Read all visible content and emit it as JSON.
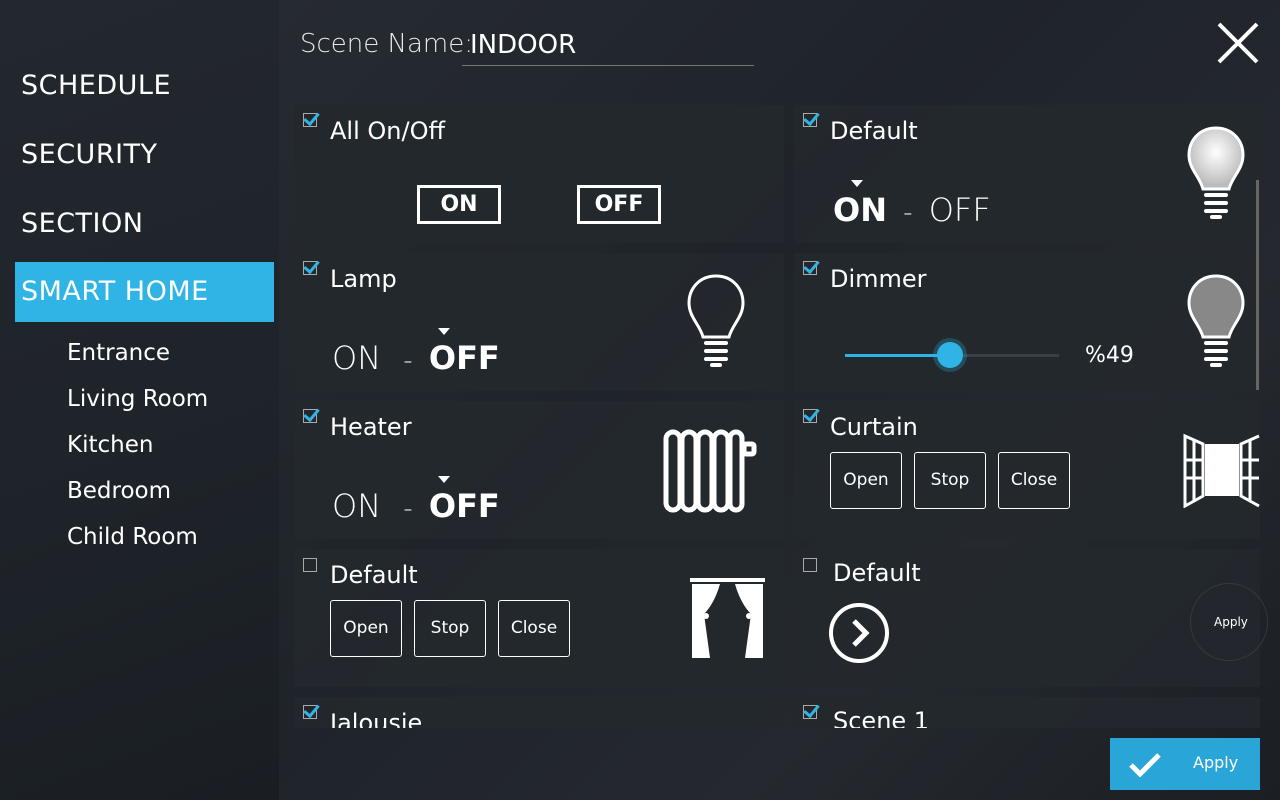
{
  "nav": {
    "items": [
      {
        "label": "SCHEDULE"
      },
      {
        "label": "SECURITY"
      },
      {
        "label": "SECTION"
      },
      {
        "label": "SMART HOME"
      }
    ],
    "sub_items": [
      {
        "label": "Entrance"
      },
      {
        "label": "Living Room"
      },
      {
        "label": "Kitchen"
      },
      {
        "label": "Bedroom"
      },
      {
        "label": "Child Room"
      }
    ],
    "active": "SMART HOME"
  },
  "scene": {
    "label": "Scene Name:",
    "value": "INDOOR"
  },
  "cards": {
    "all_onoff": {
      "title": "All On/Off",
      "checked": true,
      "on_label": "ON",
      "off_label": "OFF"
    },
    "default_light": {
      "title": "Default",
      "checked": true,
      "on": "ON",
      "sep": "-",
      "off": "OFF",
      "state": "ON"
    },
    "lamp": {
      "title": "Lamp",
      "checked": true,
      "on": "ON",
      "sep": "-",
      "off": "OFF",
      "state": "OFF"
    },
    "dimmer": {
      "title": "Dimmer",
      "checked": true,
      "value_text": "%49",
      "value": 49
    },
    "heater": {
      "title": "Heater",
      "checked": true,
      "on": "ON",
      "sep": "-",
      "off": "OFF",
      "state": "OFF"
    },
    "curtain": {
      "title": "Curtain",
      "checked": true,
      "open": "Open",
      "stop": "Stop",
      "close": "Close"
    },
    "default_curtain": {
      "title": "Default",
      "checked": false,
      "open": "Open",
      "stop": "Stop",
      "close": "Close"
    },
    "default_scene": {
      "title": "Default",
      "checked": false,
      "apply": "Apply"
    },
    "jalousie": {
      "title": "Jalousie",
      "checked": true
    },
    "scene1": {
      "title": "Scene 1",
      "checked": true
    }
  },
  "apply_button": {
    "label": "Apply"
  },
  "colors": {
    "accent": "#30b4e6",
    "background": "#1c2127",
    "card": "#24282e"
  }
}
